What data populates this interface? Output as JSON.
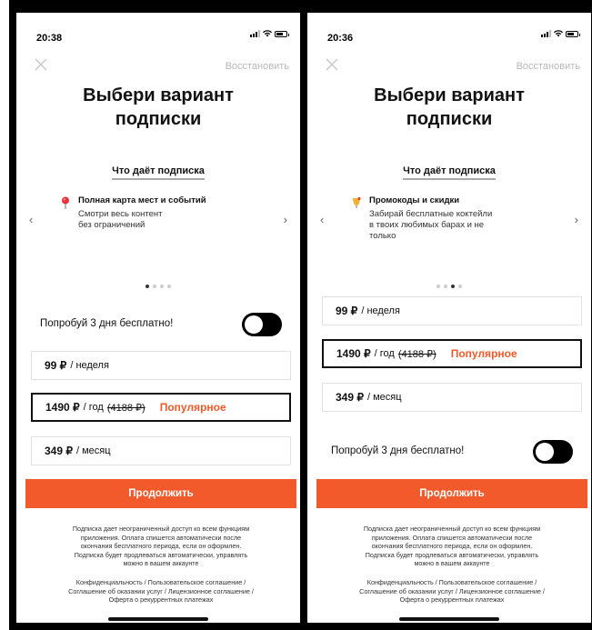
{
  "screens": [
    {
      "time": "20:38",
      "restore_label": "Восстановить",
      "title_line1": "Выбери вариант",
      "title_line2": "подписки",
      "features_link": "Что даёт подписка",
      "feature": {
        "icon": "map-pin-icon",
        "title": "Полная карта мест и событий",
        "desc": "Смотри весь контент\nбез ограничений"
      },
      "dots_active_index": 0,
      "trial_label": "Попробуй 3 дня бесплатно!",
      "plans": [
        {
          "price": "99 ₽",
          "period": "/ неделя"
        },
        {
          "price": "1490 ₽",
          "period": "/ год",
          "old_price": "(4188 ₽)",
          "badge": "Популярное",
          "selected": true
        },
        {
          "price": "349 ₽",
          "period": "/ месяц"
        }
      ],
      "continue_label": "Продолжить",
      "legal_text": "Подписка дает неограниченный доступ ко всем функциям\nприложения. Оплата спишется автоматически после\nокончания бесплатного периода, если он оформлен.\nПодписка будет продлеваться автоматически, управлять\nможно в вашем аккаунте",
      "legal_links": "Конфиденциальность / Пользовательское соглашение /\nСоглашение об оказании услуг / Лицензионное соглашение /\nОферта о рекуррентных платежах"
    },
    {
      "time": "20:36",
      "restore_label": "Восстановить",
      "title_line1": "Выбери вариант",
      "title_line2": "подписки",
      "features_link": "Что даёт подписка",
      "feature": {
        "icon": "cocktail-icon",
        "title": "Промокоды и скидки",
        "desc": "Забирай бесплатные коктейли\nв твоих любимых барах и не\nтолько"
      },
      "dots_active_index": 2,
      "trial_label": "Попробуй 3 дня бесплатно!",
      "plans": [
        {
          "price": "99 ₽",
          "period": "/ неделя"
        },
        {
          "price": "1490 ₽",
          "period": "/ год",
          "old_price": "(4188 ₽)",
          "badge": "Популярное",
          "selected": true
        },
        {
          "price": "349 ₽",
          "period": "/ месяц"
        }
      ],
      "continue_label": "Продолжить",
      "legal_text": "Подписка дает неограниченный доступ ко всем функциям\nприложения. Оплата спишется автоматически после\nокончания бесплатного периода, если он оформлен.\nПодписка будет продлеваться автоматически, управлять\nможно в вашем аккаунте",
      "legal_links": "Конфиденциальность / Пользовательское соглашение /\nСоглашение об оказании услуг / Лицензионное соглашение /\nОферта о рекуррентных платежах"
    }
  ],
  "colors": {
    "accent": "#f25a2b",
    "popular": "#f05a28"
  }
}
